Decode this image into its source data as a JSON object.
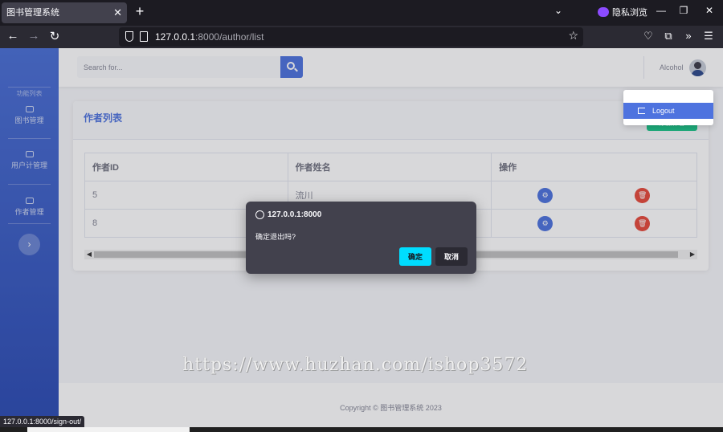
{
  "browser": {
    "tab_title": "图书管理系统",
    "tab_close": "✕",
    "new_tab": "+",
    "tab_list": "⌄",
    "private_label": "隐私浏览",
    "url_host": "127.0.0.1",
    "url_rest": ":8000/author/list",
    "status_url": "127.0.0.1:8000/sign-out/"
  },
  "sidebar": {
    "heading": "功能列表",
    "items": [
      {
        "label": "图书管理"
      },
      {
        "label": "用户计管理"
      },
      {
        "label": "作者管理"
      }
    ],
    "toggle_glyph": "›"
  },
  "topbar": {
    "search_placeholder": "Search for...",
    "username": "Alcohol"
  },
  "user_menu": {
    "logout_label": "Logout"
  },
  "card": {
    "title": "作者列表",
    "add_button": "添加作者"
  },
  "table": {
    "headers": [
      "作者ID",
      "作者姓名",
      "操作"
    ],
    "rows": [
      {
        "id": "5",
        "name": "流川"
      },
      {
        "id": "8",
        "name": ""
      }
    ]
  },
  "footer": {
    "copyright": "Copyright © 图书管理系统 2023"
  },
  "watermark": "https://www.huzhan.com/ishop3572",
  "dialog": {
    "origin": "127.0.0.1:8000",
    "message": "确定退出吗?",
    "ok_label": "确定",
    "cancel_label": "取消"
  },
  "colors": {
    "primary": "#4e73df",
    "success": "#1cc88a",
    "danger": "#e74a3b",
    "dialog_ok": "#00ddff"
  }
}
